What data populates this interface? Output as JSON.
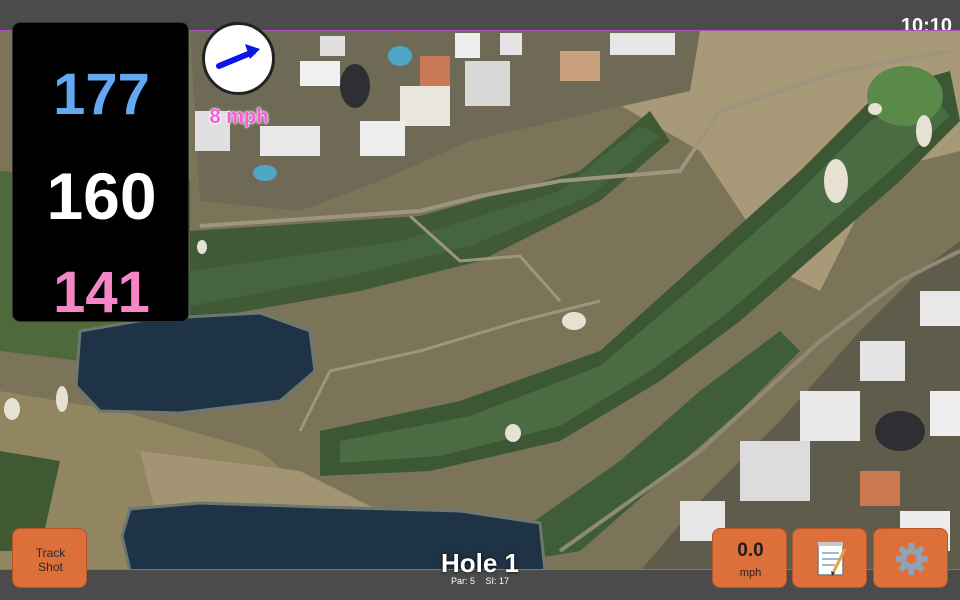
{
  "status_bar": {
    "time": "10:10"
  },
  "yardages": {
    "back": "177",
    "middle": "160",
    "front": "141",
    "colors": {
      "back": "#62a9f2",
      "middle": "#ffffff",
      "front": "#f586c6"
    }
  },
  "wind": {
    "speed": "8 mph",
    "direction_icon": "arrow-northeast-icon",
    "arrow_color": "#0a14e6"
  },
  "hole": {
    "title": "Hole 1",
    "par": "Par: 5",
    "si": "SI: 17"
  },
  "buttons": {
    "track_shot": "Track\nShot",
    "speed_value": "0.0",
    "speed_unit": "mph",
    "notes_icon": "notepad-icon",
    "settings_icon": "gear-icon"
  },
  "colors": {
    "button": "#dd6f3a",
    "map_border": "#b04fc0",
    "bar": "#4b4b4b"
  }
}
